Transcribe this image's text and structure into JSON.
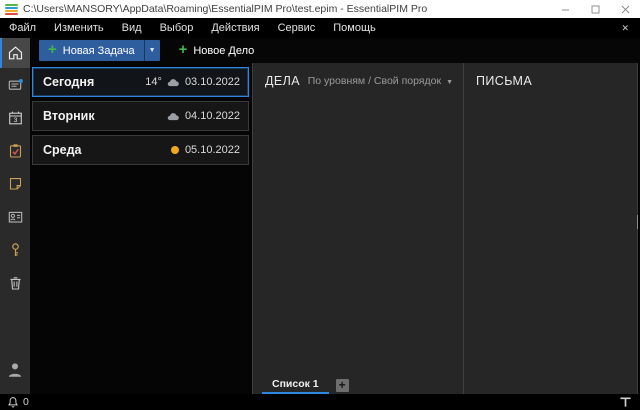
{
  "colors": {
    "accent_blue": "#2e86de",
    "button_blue": "#2f5e9e",
    "plus_green": "#43b649",
    "sun_orange": "#f2a71b",
    "gold_icon": "#c99f55",
    "panel_bg": "#262626"
  },
  "window": {
    "title": "C:\\Users\\MANSORY\\AppData\\Roaming\\EssentialPIM Pro\\test.epim - EssentialPIM Pro",
    "controls": {
      "minimize": "–",
      "maximize": "☐",
      "close": "✕"
    },
    "logo_stripes": [
      "#58b947",
      "#2e9fd4",
      "#f5a623",
      "#e04b3a"
    ]
  },
  "menu": {
    "items": [
      "Файл",
      "Изменить",
      "Вид",
      "Выбор",
      "Действия",
      "Сервис",
      "Помощь"
    ],
    "close_label": "✕"
  },
  "toolbar": {
    "new_task_label": "Новая Задача",
    "new_todo_label": "Новое Дело",
    "plus": "+"
  },
  "sidebar": {
    "items": [
      {
        "name": "today",
        "selected": true
      },
      {
        "name": "mail",
        "selected": false
      },
      {
        "name": "calendar",
        "selected": false,
        "badge": "3"
      },
      {
        "name": "tasks",
        "selected": false
      },
      {
        "name": "notes",
        "selected": false
      },
      {
        "name": "contacts",
        "selected": false
      },
      {
        "name": "passwords",
        "selected": false
      },
      {
        "name": "trash",
        "selected": false
      }
    ],
    "avatar": "user"
  },
  "day_list": {
    "rows": [
      {
        "label": "Сегодня",
        "temp": "14°",
        "weather": "cloud",
        "date": "03.10.2022",
        "selected": true
      },
      {
        "label": "Вторник",
        "temp": "",
        "weather": "cloud",
        "date": "04.10.2022",
        "selected": false
      },
      {
        "label": "Среда",
        "temp": "",
        "weather": "sun",
        "date": "05.10.2022",
        "selected": false
      }
    ]
  },
  "tasks_panel": {
    "title": "ДЕЛА",
    "sort_label": "По уровням / Свой порядок",
    "tabs": [
      {
        "label": "Список 1",
        "active": true
      }
    ],
    "add_tab_label": "+"
  },
  "mail_panel": {
    "title": "ПИСЬМА"
  },
  "status_bar": {
    "notification_count": "0"
  }
}
